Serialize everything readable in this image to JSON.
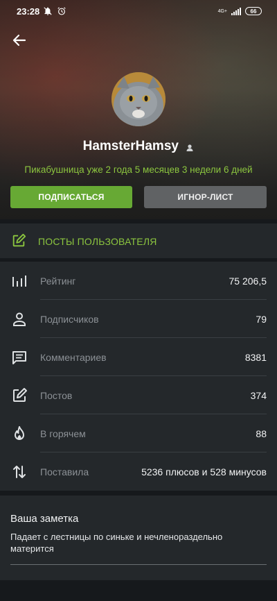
{
  "status_bar": {
    "time": "23:28",
    "network": "4G+",
    "battery": "66"
  },
  "profile": {
    "username": "HamsterHamsy",
    "since": "Пикабушница уже 2 года 5 месяцев 3 недели 6 дней",
    "subscribe_label": "ПОДПИСАТЬСЯ",
    "ignore_label": "ИГНОР-ЛИСТ"
  },
  "posts_link": {
    "label": "ПОСТЫ ПОЛЬЗОВАТЕЛЯ",
    "icon": "edit-square-icon"
  },
  "stats": [
    {
      "icon": "rating-bars-icon",
      "label": "Рейтинг",
      "value": "75 206,5"
    },
    {
      "icon": "person-icon",
      "label": "Подписчиков",
      "value": "79"
    },
    {
      "icon": "comment-icon",
      "label": "Комментариев",
      "value": "8381"
    },
    {
      "icon": "edit-square-icon",
      "label": "Постов",
      "value": "374"
    },
    {
      "icon": "fire-icon",
      "label": "В горячем",
      "value": "88"
    },
    {
      "icon": "sort-arrows-icon",
      "label": "Поставила",
      "value": "5236 плюсов и 528 минусов"
    }
  ],
  "note": {
    "title": "Ваша заметка",
    "text": "Падает с лестницы по синьке и нечленораздельно матерится"
  },
  "colors": {
    "accent_green": "#8cc63f",
    "button_green": "#67a934",
    "button_gray": "#606264",
    "card_bg": "#24282b",
    "page_bg": "#16191c"
  }
}
